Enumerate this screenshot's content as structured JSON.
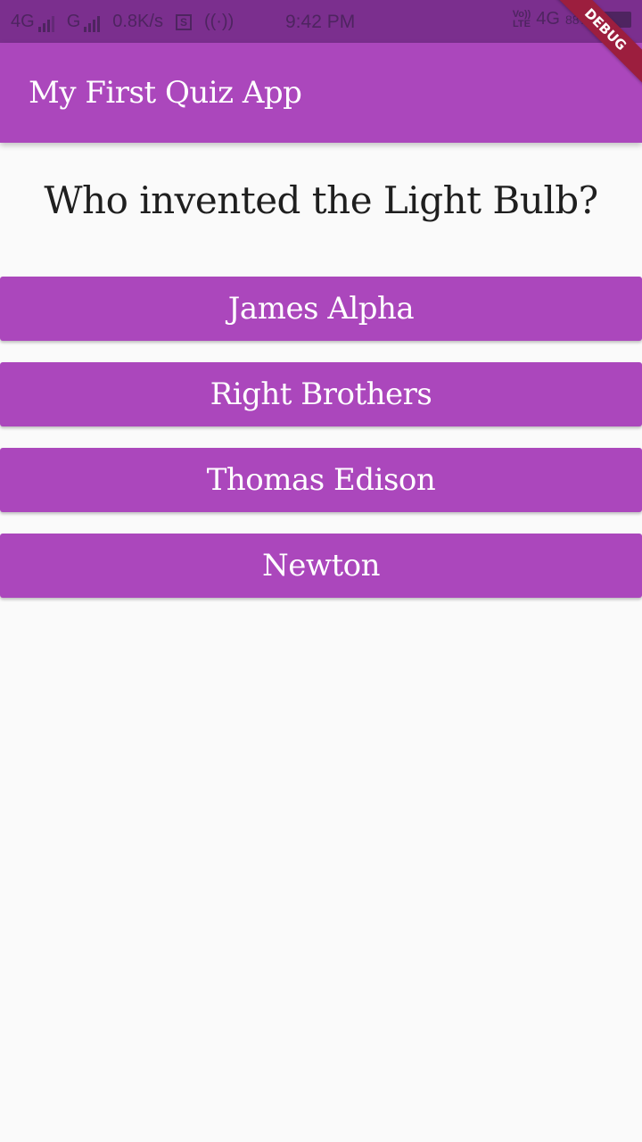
{
  "status_bar": {
    "net1": "4G",
    "net2": "G",
    "speed": "0.8K/s",
    "box_icon_text": "S",
    "time": "9:42 PM",
    "volte_top": "Vo))",
    "volte_bottom": "LTE",
    "net_right": "4G",
    "battery_text": "88%"
  },
  "appbar": {
    "title": "My First Quiz App"
  },
  "debug_banner": "DEBUG",
  "quiz": {
    "question": "Who invented the Light Bulb?",
    "answers": [
      "James Alpha",
      "Right Brothers",
      "Thomas Edison",
      "Newton"
    ]
  },
  "colors": {
    "primary": "#ab47bc",
    "status_bar": "#7b2f8e",
    "background": "#fafafa",
    "debug_ribbon": "#9c1e3e"
  }
}
